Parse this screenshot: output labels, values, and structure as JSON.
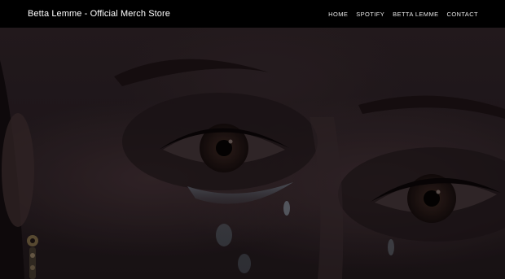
{
  "header": {
    "site_title": "Betta Lemme - Official Merch Store",
    "nav": [
      {
        "label": "HOME"
      },
      {
        "label": "SPOTIFY"
      },
      {
        "label": "BETTA LEMME"
      },
      {
        "label": "CONTACT"
      }
    ]
  },
  "colors": {
    "header_bg": "#000000",
    "header_text": "#ffffff"
  }
}
